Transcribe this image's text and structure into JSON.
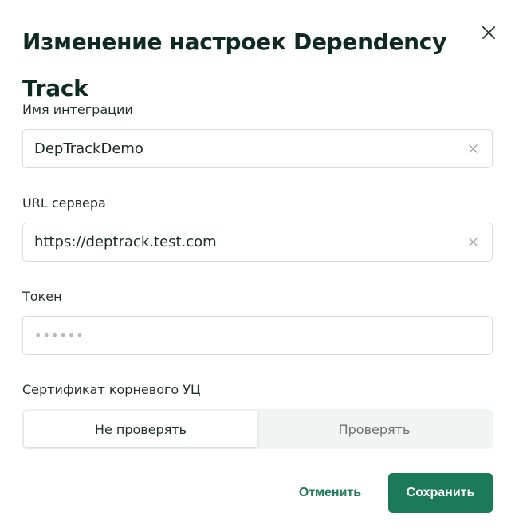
{
  "dialog": {
    "title": "Изменение настроек Dependency Track"
  },
  "fields": {
    "integration_name": {
      "label": "Имя интеграции",
      "value": "DepTrackDemo"
    },
    "server_url": {
      "label": "URL сервера",
      "value": "https://deptrack.test.com"
    },
    "token": {
      "label": "Токен",
      "placeholder": "••••••"
    }
  },
  "certificate": {
    "label": "Сертификат корневого УЦ",
    "options": [
      "Не проверять",
      "Проверять"
    ],
    "selected": "Не проверять"
  },
  "actions": {
    "cancel_label": "Отменить",
    "save_label": "Сохранить"
  },
  "colors": {
    "primary": "#1b7a5a",
    "title": "#0e2a22",
    "border": "#d9dcdb"
  }
}
